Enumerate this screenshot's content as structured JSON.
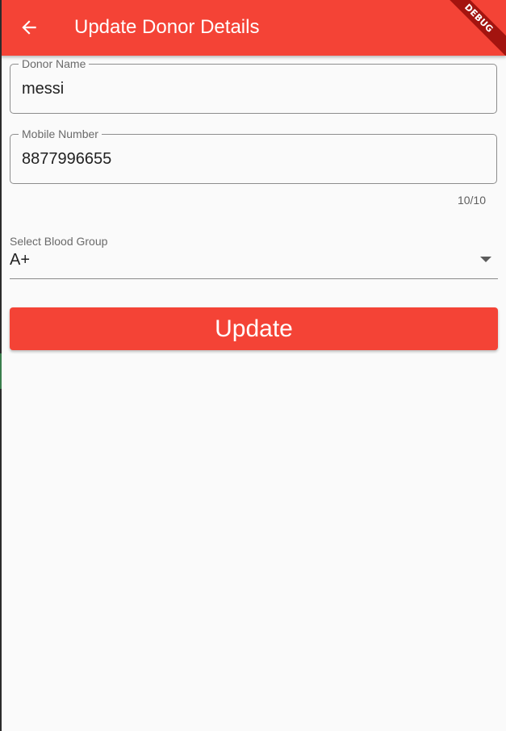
{
  "app_bar": {
    "title": "Update Donor Details",
    "back_icon": "arrow-back-icon",
    "color": "#f44336",
    "debug_banner_label": "DEBUG",
    "debug_banner_color": "#a3140f"
  },
  "form": {
    "donor_name": {
      "label": "Donor Name",
      "value": "messi"
    },
    "mobile_number": {
      "label": "Mobile Number",
      "value": "8877996655",
      "counter": "10/10"
    },
    "blood_group": {
      "label": "Select Blood Group",
      "selected": "A+",
      "arrow_icon": "dropdown-arrow-icon"
    },
    "update_button": {
      "label": "Update",
      "color": "#f44336"
    }
  }
}
